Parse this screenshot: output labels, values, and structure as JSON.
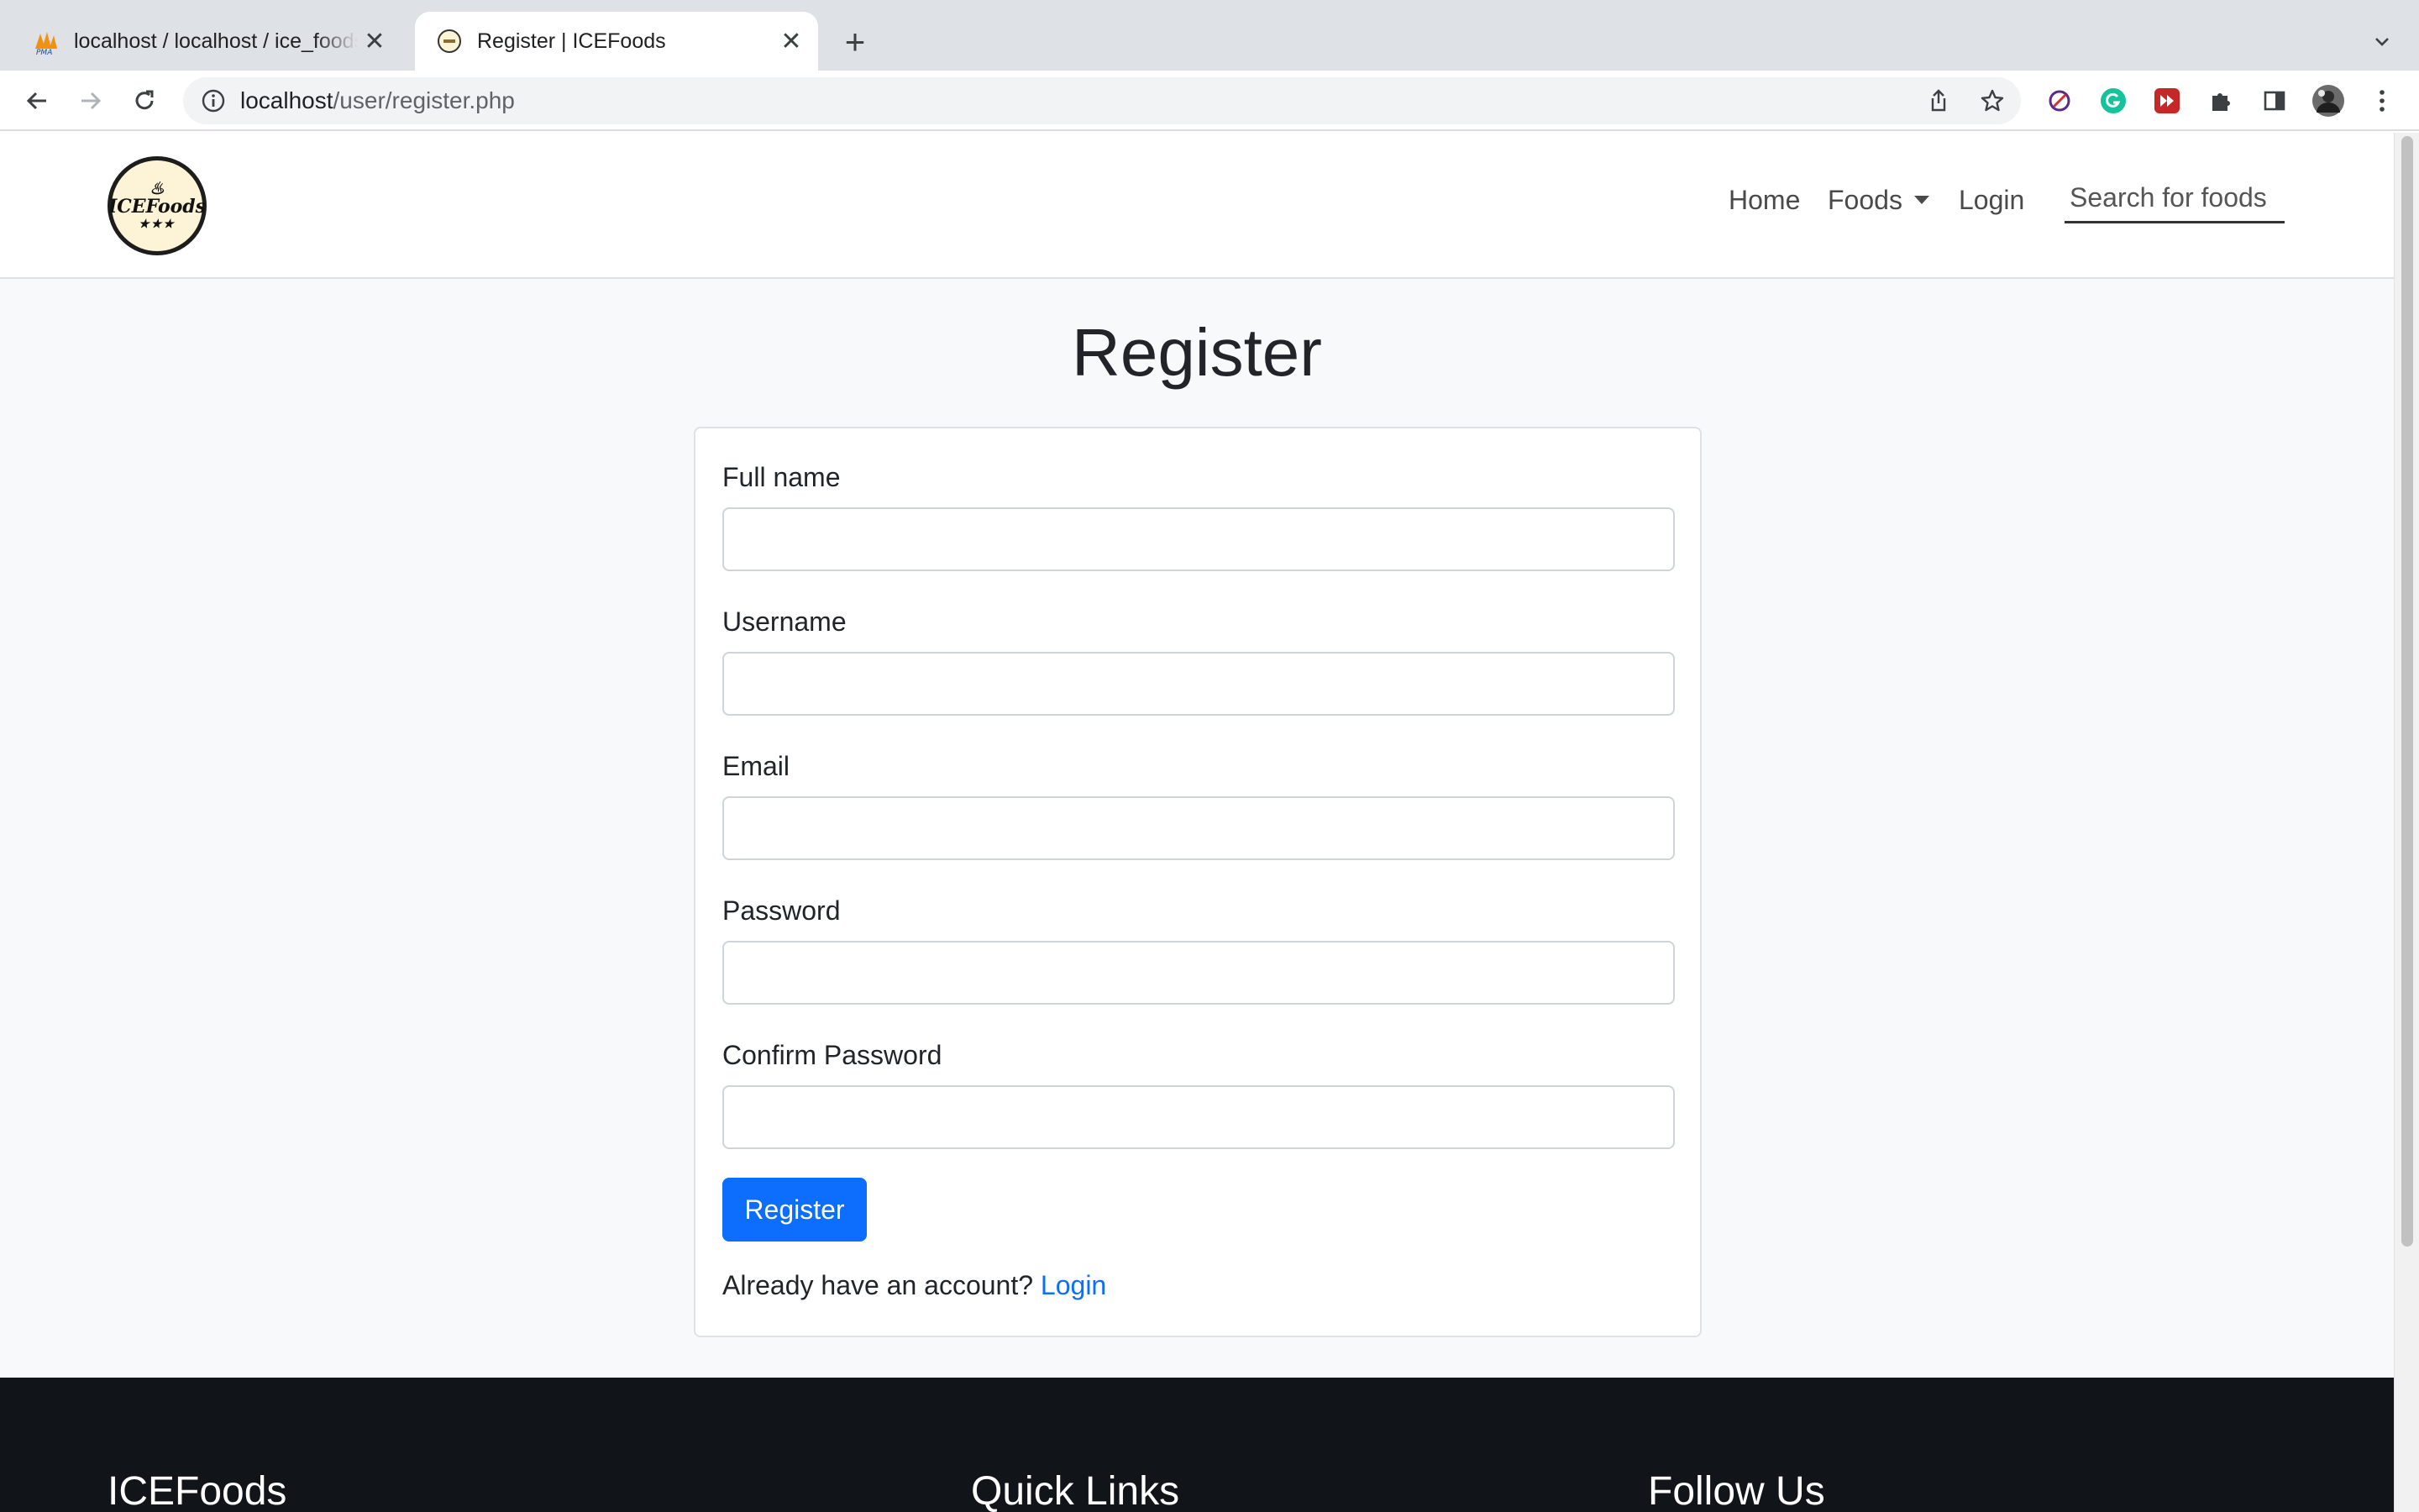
{
  "browser": {
    "tabs": [
      {
        "title": "localhost / localhost / ice_foods",
        "favicon": "phpmyadmin-icon",
        "active": false
      },
      {
        "title": "Register | ICEFoods",
        "favicon": "icefoods-logo-icon",
        "active": true
      }
    ],
    "address": {
      "host": "localhost",
      "path": "/user/register.php"
    }
  },
  "navbar": {
    "brand": "ICEFoods",
    "links": {
      "home": "Home",
      "foods": "Foods",
      "login": "Login"
    },
    "search_placeholder": "Search for foods"
  },
  "page": {
    "title": "Register",
    "form": {
      "fullname_label": "Full name",
      "username_label": "Username",
      "email_label": "Email",
      "password_label": "Password",
      "confirm_label": "Confirm Password",
      "submit_label": "Register",
      "login_prompt": "Already have an account?",
      "login_link": "Login"
    }
  },
  "footer": {
    "brand_heading": "ICEFoods",
    "quick_links_heading": "Quick Links",
    "follow_heading": "Follow Us"
  },
  "colors": {
    "primary": "#0d6efd",
    "footer_bg": "#111418",
    "page_bg": "#f8f9fa"
  }
}
